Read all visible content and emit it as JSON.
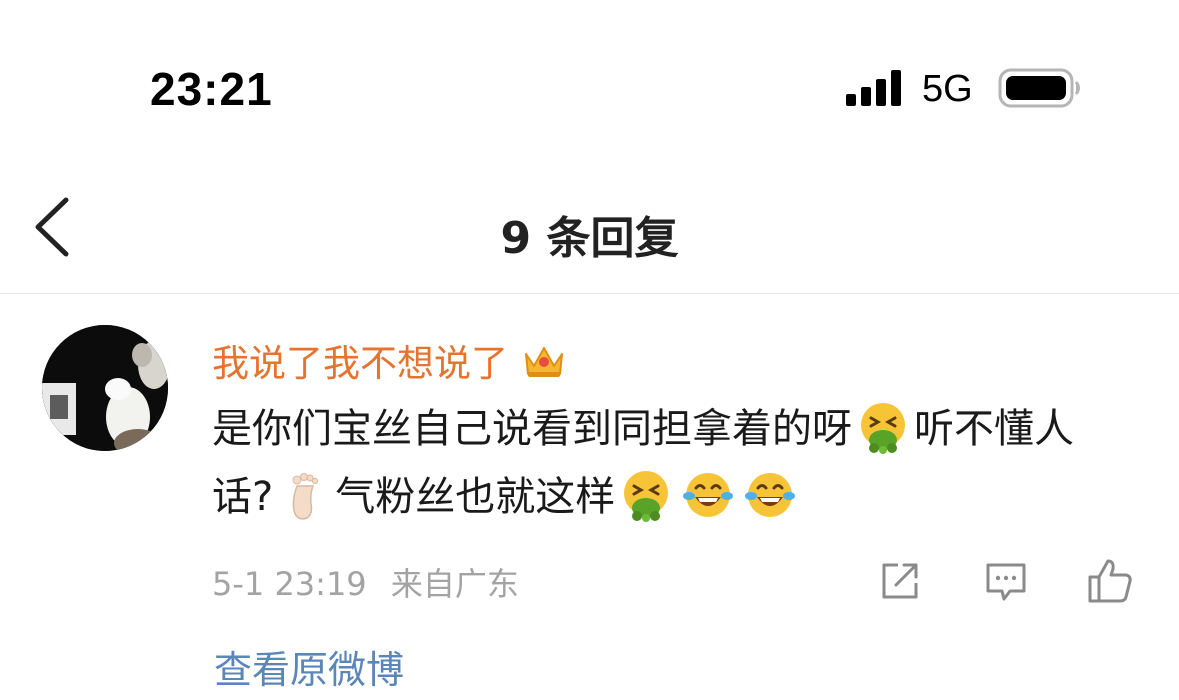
{
  "status_bar": {
    "time": "23:21",
    "network": "5G",
    "icons": [
      "signal-icon",
      "battery-icon"
    ]
  },
  "nav": {
    "title": "9 条回复",
    "back_icon": "chevron-left-icon"
  },
  "comment": {
    "username": "我说了我不想说了",
    "username_color": "#e6732e",
    "badge_icon": "crown-badge-icon",
    "text_part1": "是你们宝丝自己说看到同担拿着的呀",
    "text_part2": "听不懂人话?",
    "text_part3": "气粉丝也就这样",
    "emojis": [
      "vomit-emoji",
      "foot-emoji",
      "vomit-emoji",
      "laugh-cry-emoji",
      "laugh-cry-emoji"
    ],
    "date": "5-1 23:19",
    "location": "来自广东",
    "view_original": "查看原微博",
    "link_color": "#5b86b8",
    "actions": [
      "share-icon",
      "comment-icon",
      "like-icon"
    ]
  }
}
